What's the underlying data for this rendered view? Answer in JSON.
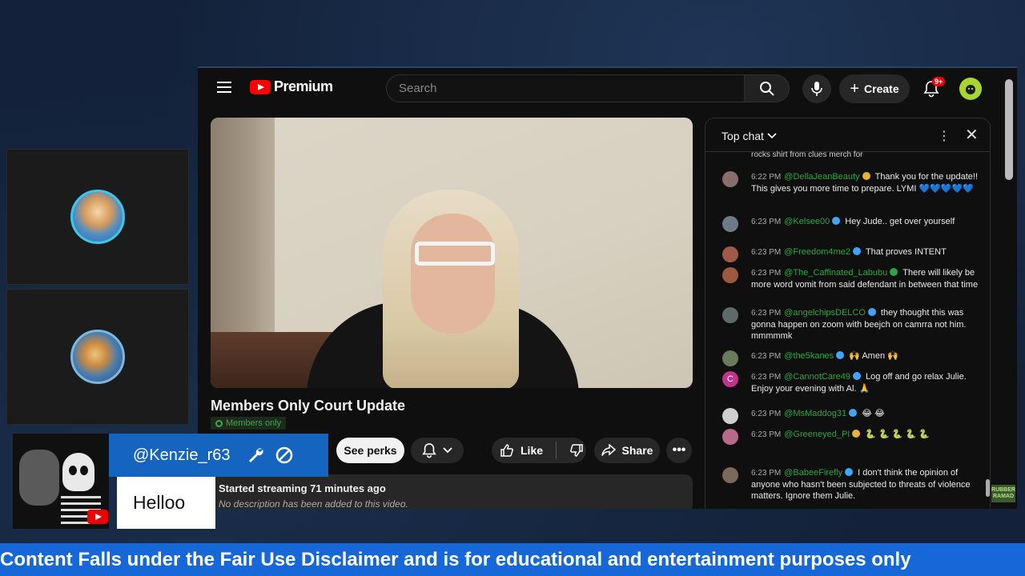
{
  "app": {
    "logo_text": "Premium",
    "search_placeholder": "Search",
    "create_label": "Create",
    "notification_count": "9+"
  },
  "video": {
    "title": "Members Only Court Update",
    "badge": "Members only",
    "see_perks": "See perks",
    "like_label": "Like",
    "share_label": "Share",
    "description_stream": "Started streaming 71 minutes ago",
    "description_empty": "No description has been added to this video."
  },
  "chat": {
    "mode": "Top chat",
    "cut_line": "rocks shirt from clues merch for",
    "messages": [
      {
        "time": "6:22 PM",
        "author": "@DellaJeanBeauty",
        "badge": "gold",
        "text": "Thank you for the update!! This gives you more time to prepare. LYMI 💙💙💙💙💙",
        "avatar_color": "#8a6d6d"
      },
      {
        "time": "6:23 PM",
        "author": "@Kelsee00",
        "badge": "blue",
        "text": "Hey Jude.. get over yourself",
        "avatar_color": "#6c7a8a"
      },
      {
        "time": "6:23 PM",
        "author": "@Freedom4me2",
        "badge": "blue",
        "text": "That proves INTENT",
        "avatar_color": "#a05a4a"
      },
      {
        "time": "6:23 PM",
        "author": "@The_Caffinated_Labubu",
        "badge": "green",
        "text": "There will likely be more word vomit from said defendant in between that time",
        "avatar_color": "#9a5a40"
      },
      {
        "time": "6:23 PM",
        "author": "@angelchipsDELCO",
        "badge": "blue",
        "text": "they thought this was gonna happen on zoom with beejch on camrra not him. mmmmmk",
        "avatar_color": "#5e6a6a"
      },
      {
        "time": "6:23 PM",
        "author": "@the5kanes",
        "badge": "blue",
        "text": "🙌 Amen 🙌",
        "avatar_color": "#6a7a5a"
      },
      {
        "time": "6:23 PM",
        "author": "@CannotCare49",
        "badge": "blue",
        "text": "Log off and go relax Julie. Enjoy your evening with Al. 🙏",
        "avatar_color": "#c2338a",
        "avatar_letter": "C"
      },
      {
        "time": "6:23 PM",
        "author": "@MsMaddog31",
        "badge": "blue",
        "text": "😂 😂",
        "avatar_color": "#cfcfcf"
      },
      {
        "time": "6:23 PM",
        "author": "@Greeneyed_PI",
        "badge": "gold",
        "text": "🐍 🐍 🐍 🐍 🐍",
        "avatar_color": "#b86a8a"
      },
      {
        "time": "6:23 PM",
        "author": "@BabeeFirefly",
        "badge": "blue",
        "text": "I don't think the opinion of anyone who hasn't been subjected to threats of violence matters. Ignore them Julie.",
        "avatar_color": "#7a6a5a"
      }
    ]
  },
  "overlay": {
    "handle": "@Kenzie_r63",
    "message": "Helloo"
  },
  "ticker": {
    "text": "Content Falls under the Fair Use Disclaimer and is for educational and entertainment purposes only"
  },
  "corner_logo": "RUBBER RAMAD"
}
